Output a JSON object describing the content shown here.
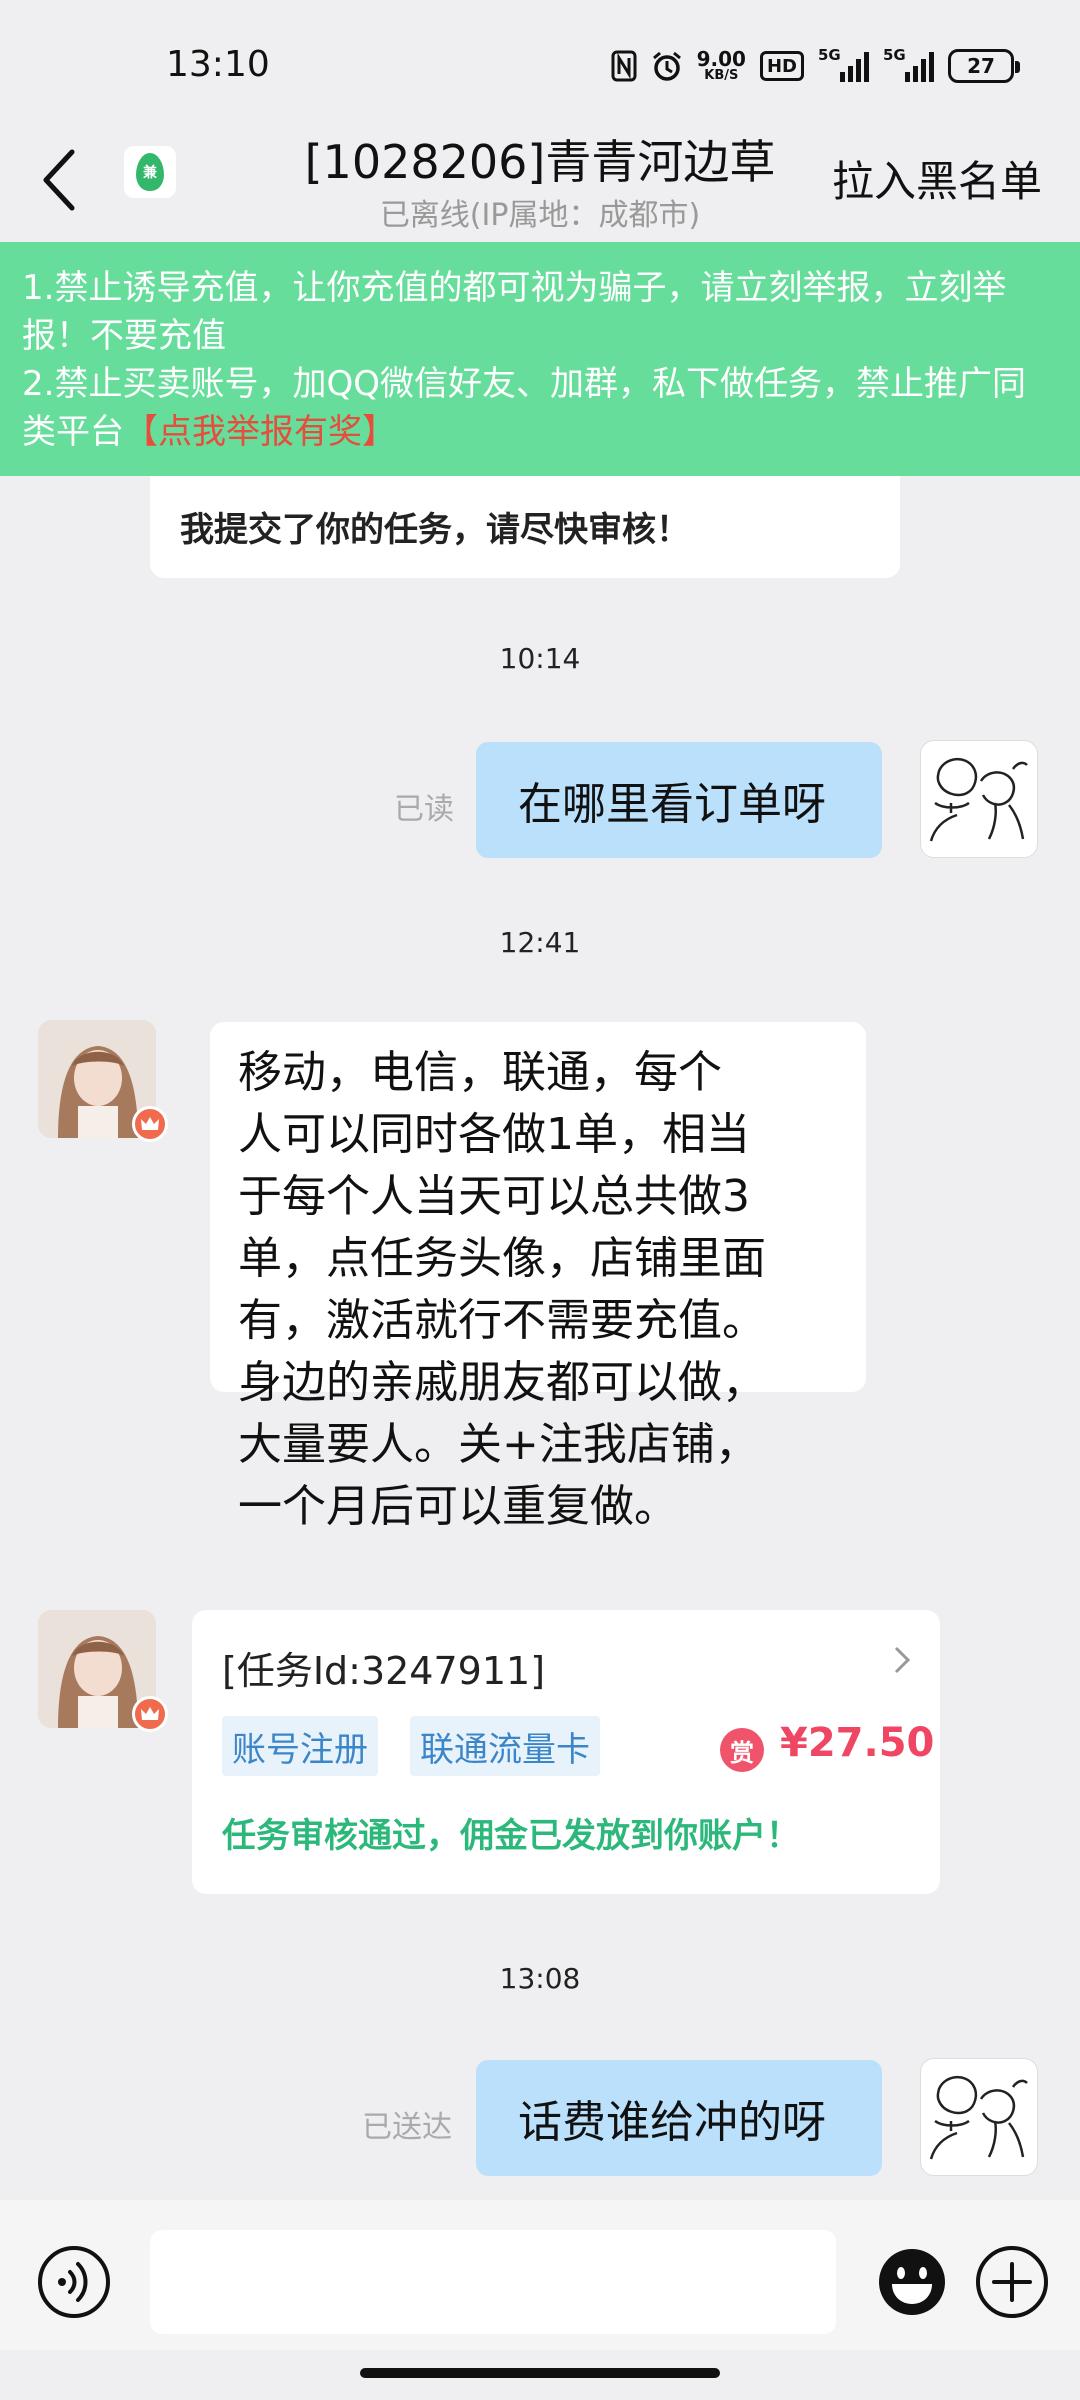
{
  "status_bar": {
    "time": "13:10",
    "net_speed_value": "9.00",
    "net_speed_unit": "KB/S",
    "hd": "HD",
    "signal1": "5G",
    "signal2": "5G",
    "battery": "27"
  },
  "header": {
    "title": "[1028206]青青河边草",
    "subtitle": "已离线(IP属地：成都市)",
    "blacklist_label": "拉入黑名单",
    "logo_text": "兼"
  },
  "notice": {
    "line1": "1.禁止诱导充值，让你充值的都可视为骗子，请立刻举报，立刻举报！不要充值",
    "line2": "2.禁止买卖账号，加QQ微信好友、加群，私下做任务，禁止推广同类平台",
    "report_link": "【点我举报有奖】"
  },
  "messages": {
    "m1_text": "我提交了你的任务，请尽快审核！",
    "ts1": "10:14",
    "m2_status": "已读",
    "m2_text": "在哪里看订单呀",
    "ts2": "12:41",
    "m3_lines": [
      "移动，电信，联通，每个",
      "人可以同时各做1单，相当",
      "于每个人当天可以总共做3",
      "单，点任务头像，店铺里面",
      "有，激活就行不需要充值。",
      "身边的亲戚朋友都可以做，",
      "大量要人。关+注我店铺，",
      "一个月后可以重复做。"
    ],
    "task": {
      "id_text": "[任务Id:3247911]",
      "tag1": "账号注册",
      "tag2": "联通流量卡",
      "reward_icon": "赏",
      "amount": "¥27.50",
      "status": "任务审核通过，佣金已发放到你账户！"
    },
    "ts3": "13:08",
    "m5_status": "已送达",
    "m5_text": "话费谁给冲的呀"
  },
  "input": {
    "placeholder": ""
  },
  "icons": {
    "back": "back-arrow-icon",
    "voice": "voice-icon",
    "emoji": "emoji-icon",
    "plus": "plus-icon"
  },
  "colors": {
    "notice_bg": "#66dd9b",
    "report_link": "#e74c3c",
    "sent_bubble": "#bbe0fb",
    "amount": "#ef4763",
    "task_status": "#2bb87a",
    "tag_text": "#3a86c8"
  }
}
